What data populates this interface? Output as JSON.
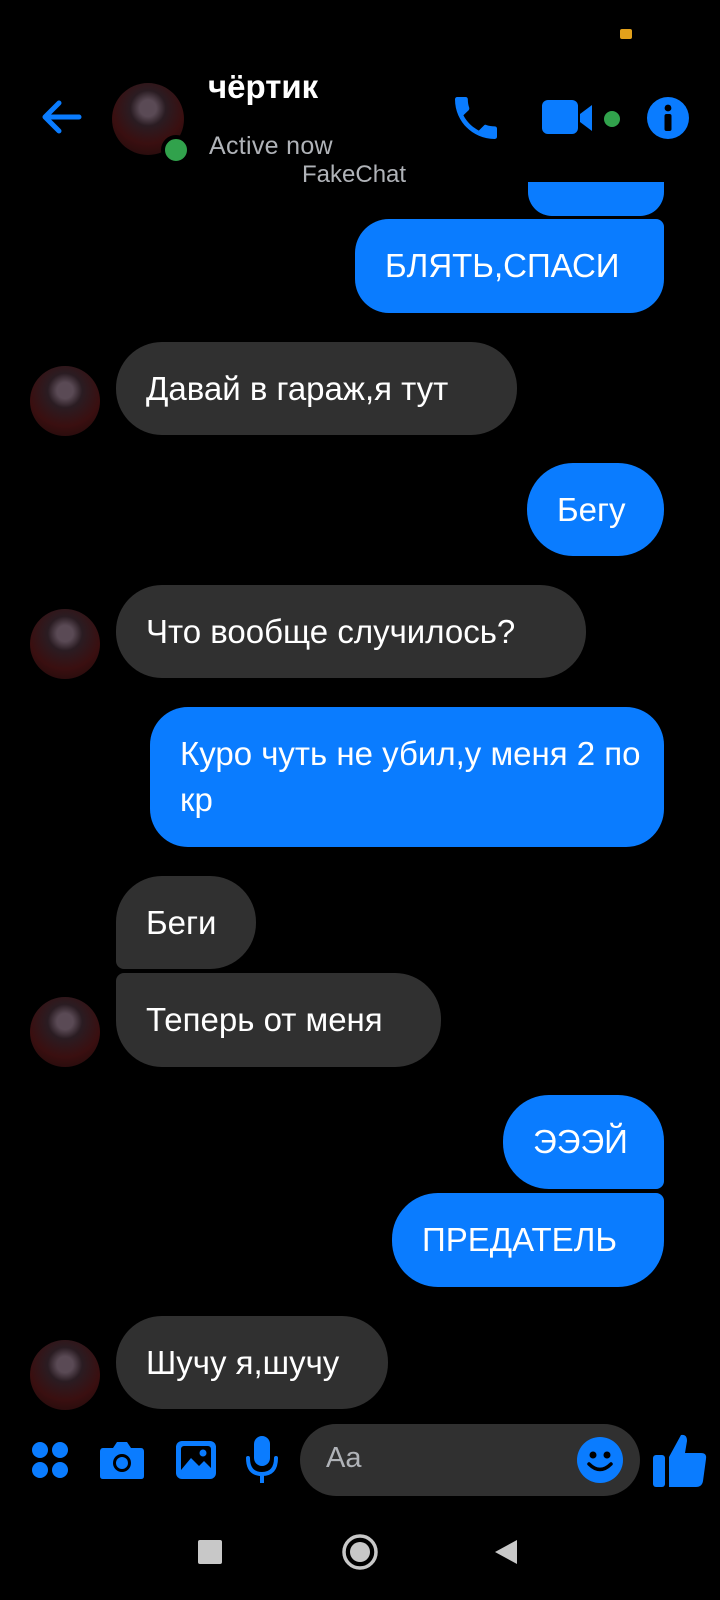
{
  "header": {
    "contact_name": "чёртик",
    "status": "Active now",
    "watermark": "FakeChat"
  },
  "messages": [
    {
      "from": "me",
      "text": "БЛЯТЬ,СПАСИ"
    },
    {
      "from": "them",
      "text": "Давай в гараж,я тут"
    },
    {
      "from": "me",
      "text": "Бегу"
    },
    {
      "from": "them",
      "text": "Что вообще случилось?"
    },
    {
      "from": "me",
      "text": "Куро чуть не убил,у меня 2 по кр"
    },
    {
      "from": "them",
      "text": "Беги"
    },
    {
      "from": "them",
      "text": "Теперь от меня"
    },
    {
      "from": "me",
      "text": "ЭЭЭЙ"
    },
    {
      "from": "me",
      "text": "ПРЕДАТЕЛЬ"
    },
    {
      "from": "them",
      "text": "Шучу я,шучу"
    }
  ],
  "composer": {
    "placeholder": "Aa",
    "icons": [
      "apps-icon",
      "camera-icon",
      "image-icon",
      "microphone-icon",
      "emoji-icon",
      "thumbs-up-icon"
    ]
  },
  "colors": {
    "accent": "#0a7cff",
    "incoming_bubble": "#303030",
    "online": "#31a24c",
    "background": "#000000"
  }
}
